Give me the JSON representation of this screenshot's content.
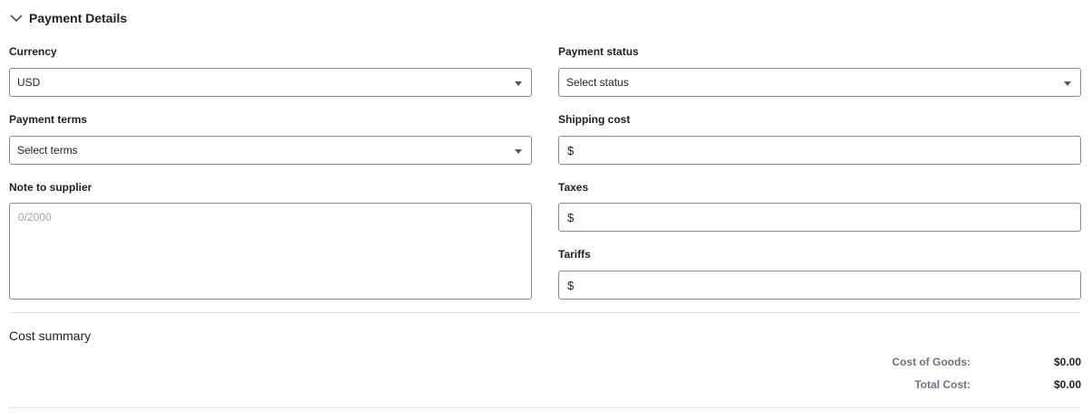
{
  "section": {
    "title": "Payment Details",
    "icon": "chevron-down-icon"
  },
  "fields": {
    "currency": {
      "label": "Currency",
      "value": "USD"
    },
    "payment_status": {
      "label": "Payment status",
      "value": "Select status"
    },
    "payment_terms": {
      "label": "Payment terms",
      "value": "Select terms"
    },
    "shipping_cost": {
      "label": "Shipping cost",
      "prefix": "$",
      "value": ""
    },
    "note": {
      "label": "Note to supplier",
      "placeholder": "0/2000",
      "value": ""
    },
    "taxes": {
      "label": "Taxes",
      "prefix": "$",
      "value": ""
    },
    "tariffs": {
      "label": "Tariffs",
      "prefix": "$",
      "value": ""
    }
  },
  "summary": {
    "title": "Cost summary",
    "rows": [
      {
        "label": "Cost of Goods:",
        "value": "$0.00"
      },
      {
        "label": "Total Cost:",
        "value": "$0.00"
      }
    ]
  }
}
